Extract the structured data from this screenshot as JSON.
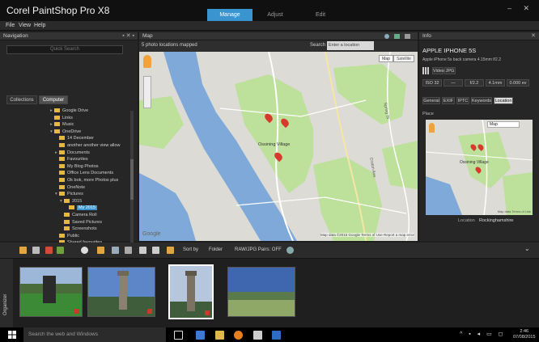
{
  "app": {
    "title": "Corel PaintShop Pro X8",
    "tabs": [
      "Manage",
      "Adjust",
      "Edit"
    ],
    "window_controls": "–  ✕"
  },
  "menu": [
    "File",
    "View",
    "Help"
  ],
  "navigation": {
    "title": "Navigation",
    "controls": "▪ ✕ ▪",
    "search_placeholder": "Quick Search",
    "tabs": [
      "Collections",
      "Computer"
    ],
    "tree": [
      {
        "label": "Google Drive",
        "indent": 1,
        "toggle": "▸"
      },
      {
        "label": "Links",
        "indent": 1,
        "toggle": ""
      },
      {
        "label": "Music",
        "indent": 1,
        "toggle": "▸"
      },
      {
        "label": "OneDrive",
        "indent": 1,
        "toggle": "▾"
      },
      {
        "label": "14 December",
        "indent": 2,
        "toggle": ""
      },
      {
        "label": "another another view allow",
        "indent": 2,
        "toggle": ""
      },
      {
        "label": "Documents",
        "indent": 2,
        "toggle": "▸"
      },
      {
        "label": "Favourites",
        "indent": 2,
        "toggle": ""
      },
      {
        "label": "My Blog Photos",
        "indent": 2,
        "toggle": ""
      },
      {
        "label": "Office Lens Documents",
        "indent": 2,
        "toggle": ""
      },
      {
        "label": "Ok bok, more Photos plus",
        "indent": 2,
        "toggle": ""
      },
      {
        "label": "OneNote",
        "indent": 2,
        "toggle": ""
      },
      {
        "label": "Pictures",
        "indent": 2,
        "toggle": "▾"
      },
      {
        "label": "2015",
        "indent": 3,
        "toggle": "▾"
      },
      {
        "label": "My 2015",
        "indent": 4,
        "toggle": "",
        "selected": true
      },
      {
        "label": "Camera Roll",
        "indent": 3,
        "toggle": ""
      },
      {
        "label": "Saved Pictures",
        "indent": 3,
        "toggle": ""
      },
      {
        "label": "Screenshots",
        "indent": 3,
        "toggle": ""
      },
      {
        "label": "Public",
        "indent": 2,
        "toggle": ""
      },
      {
        "label": "Shared favourites",
        "indent": 2,
        "toggle": ""
      },
      {
        "label": "Synched files folder",
        "indent": 2,
        "toggle": ""
      }
    ]
  },
  "map": {
    "title": "Map",
    "status": "5 photo locations mapped",
    "search_label": "Search",
    "search_placeholder": "Enter a location",
    "types": [
      "Map",
      "Satellite"
    ],
    "place_label": "Ossining Village",
    "road_label_1": "Spring St",
    "road_label_2": "Croton Ave",
    "footer": "Map data ©2015 Google   Terms of Use   Report a map error",
    "google": "Google"
  },
  "info": {
    "title": "Info",
    "camera_title": "APPLE IPHONE 5S",
    "camera_desc": "Apple iPhone 5s back camera 4.15mm f/2.2",
    "format_badges": [
      "Video",
      "JPG"
    ],
    "exif": [
      "ISO 32",
      "—",
      "f/2.2",
      "4.1mm",
      "0.000 ev"
    ],
    "tabs": [
      "General",
      "EXIF",
      "IPTC",
      "Keywords",
      "Location"
    ],
    "place_label": "Place",
    "map_type": "Map",
    "map_place": "Ossining Village",
    "map_footer": "Map data   Terms of Use",
    "location_label": "Location",
    "location_value": "Rockinghamshire"
  },
  "filmstrip": {
    "sort_label": "Sort by",
    "folder_label": "Folder",
    "raw_label": "RAW/JPG Pairs: OFF",
    "organizer_label": "Organizer"
  },
  "taskbar": {
    "search_text": "Search the web and Windows",
    "time": "2:46",
    "date": "07/08/2015"
  },
  "colors": {
    "accent": "#3a94cf",
    "map_bg": "#dcdbd6",
    "map_park": "#bde09b",
    "map_water": "#7fa9d8",
    "folder": "#e5b841",
    "pin": "#d63a2d"
  }
}
